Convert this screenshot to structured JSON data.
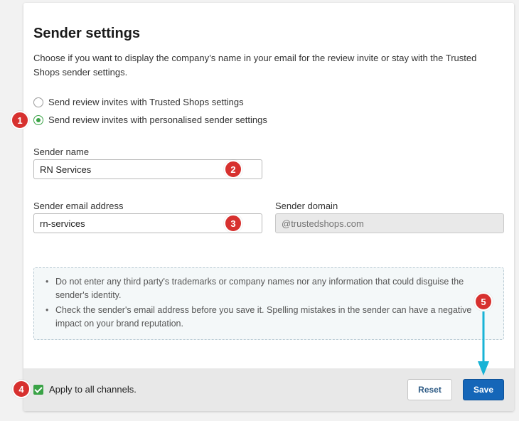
{
  "panel": {
    "title": "Sender settings",
    "description": "Choose if you want to display the company’s name in your email for the review invite or stay with the Trusted Shops sender settings."
  },
  "options": {
    "trusted_label": "Send review invites with Trusted Shops settings",
    "personalised_label": "Send review invites with personalised sender settings",
    "selected": "personalised"
  },
  "sender_name": {
    "label": "Sender name",
    "value": "RN Services"
  },
  "sender_email": {
    "label": "Sender email address",
    "value": "rn-services"
  },
  "sender_domain": {
    "label": "Sender domain",
    "placeholder": "@trustedshops.com"
  },
  "info": {
    "items": [
      "Do not enter any third party's trademarks or company names nor any information that could disguise the sender's identity.",
      "Check the sender's email address before you save it. Spelling mistakes in the sender can have a negative impact on your brand reputation."
    ]
  },
  "footer": {
    "apply_label": "Apply to all channels.",
    "apply_checked": true,
    "reset_label": "Reset",
    "save_label": "Save"
  },
  "annotations": {
    "b1": "1",
    "b2": "2",
    "b3": "3",
    "b4": "4",
    "b5": "5"
  },
  "colors": {
    "accent_green": "#3aa346",
    "primary_blue": "#1566b8",
    "badge_red": "#d7312f",
    "arrow_cyan": "#18b3d6"
  }
}
